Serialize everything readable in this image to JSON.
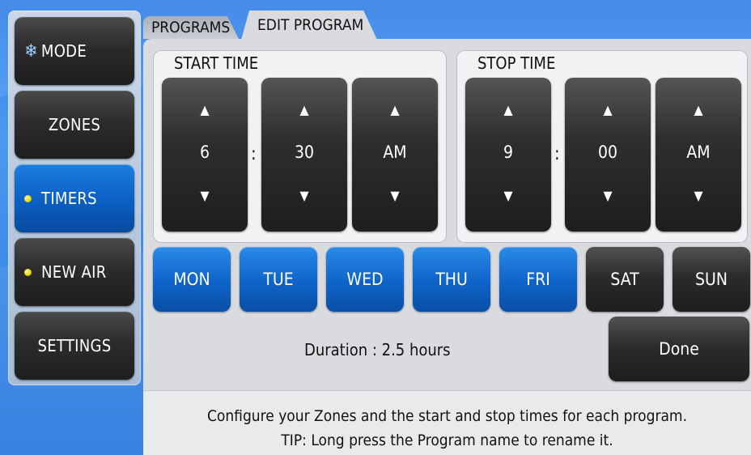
{
  "nav": {
    "mode": "MODE",
    "zones": "ZONES",
    "timers": "TIMERS",
    "new_air": "NEW AIR",
    "settings": "SETTINGS"
  },
  "tabs": {
    "programs": "PROGRAMS",
    "edit_program": "EDIT PROGRAM"
  },
  "start": {
    "title": "START TIME",
    "hour": "6",
    "minute": "30",
    "ampm": "AM"
  },
  "stop": {
    "title": "STOP TIME",
    "hour": "9",
    "minute": "00",
    "ampm": "AM"
  },
  "separator": ":",
  "arrows": {
    "up": "▲",
    "down": "▼"
  },
  "days": [
    {
      "label": "MON",
      "selected": true
    },
    {
      "label": "TUE",
      "selected": true
    },
    {
      "label": "WED",
      "selected": true
    },
    {
      "label": "THU",
      "selected": true
    },
    {
      "label": "FRI",
      "selected": true
    },
    {
      "label": "SAT",
      "selected": false
    },
    {
      "label": "SUN",
      "selected": false
    }
  ],
  "duration": "Duration : 2.5 hours",
  "done": "Done",
  "help": {
    "line1": "Configure your Zones and the start and stop times for each program.",
    "line2": "TIP: Long press the Program name to rename it."
  },
  "colors": {
    "accent_blue": "#0e63c8",
    "button_dark": "#2c2c2c",
    "indicator_yellow": "#e8d400"
  }
}
